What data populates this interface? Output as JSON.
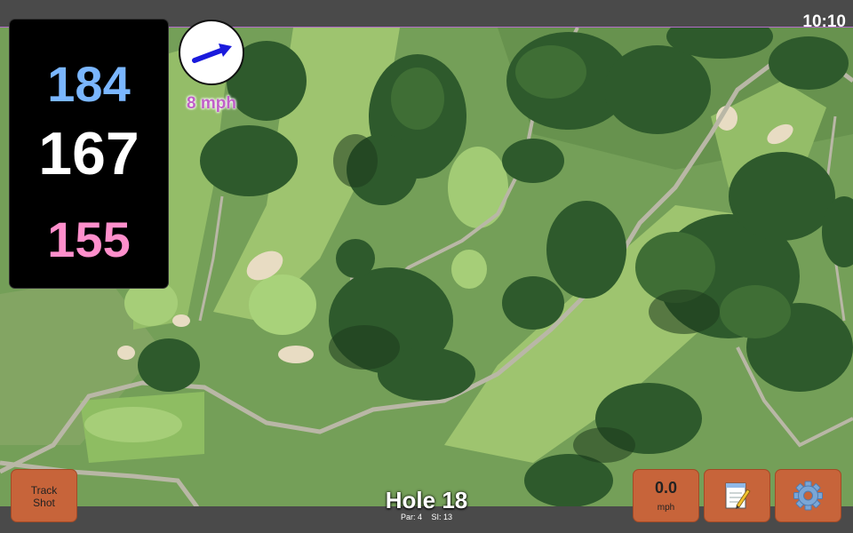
{
  "status_bar": {
    "time": "10:10"
  },
  "distances": {
    "back": "184",
    "middle": "167",
    "front": "155"
  },
  "distance_colors": {
    "back": "#7ab6ff",
    "middle": "#ffffff",
    "front": "#ff8fcc"
  },
  "wind": {
    "speed_label": "8 mph",
    "arrow_icon": "wind-direction-arrow",
    "arrow_color": "#1a1adc"
  },
  "buttons": {
    "track_shot_line1": "Track",
    "track_shot_line2": "Shot",
    "speed_value": "0.0",
    "speed_unit": "mph",
    "notes_icon": "notepad-pencil-icon",
    "settings_icon": "gear-icon",
    "accent": "#c7643a"
  },
  "hole": {
    "title": "Hole 18",
    "par": "Par: 4",
    "si": "SI: 13"
  }
}
